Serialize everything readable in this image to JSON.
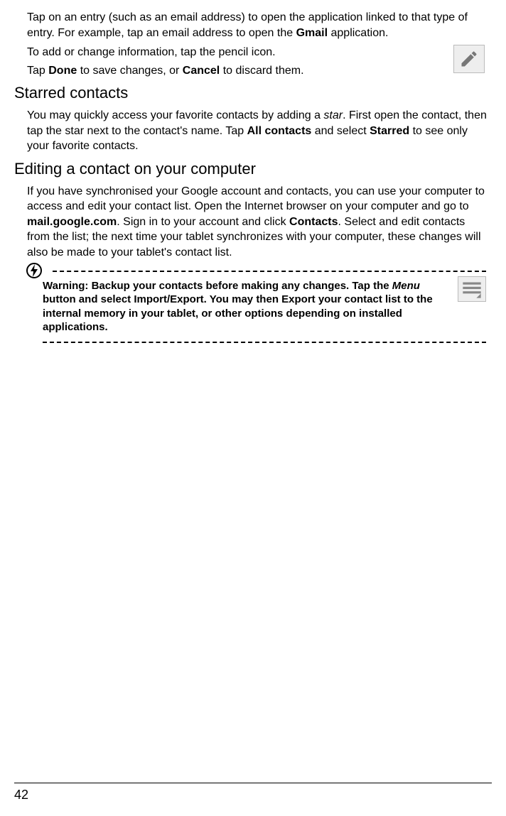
{
  "intro": {
    "tapEntry_pre": "Tap on an entry (such as an email address) to open the application linked to that type of entry. For example, tap an email address to open the ",
    "gmail": "Gmail",
    "tapEntry_post": " application.",
    "pencil": "To add or change information, tap the pencil icon.",
    "done_pre": "Tap ",
    "done": "Done",
    "done_mid": " to save changes, or ",
    "cancel": "Cancel",
    "done_post": " to discard them."
  },
  "starred": {
    "heading": "Starred contacts",
    "body_pre": "You may quickly access your favorite contacts by adding a ",
    "star": "star",
    "body_mid1": ". First open the contact, then tap the star next to the contact's name. Tap ",
    "allcontacts": "All contacts",
    "body_mid2": "  and select ",
    "starredword": "Starred",
    "body_post": " to see only your favorite contacts."
  },
  "editing": {
    "heading": "Editing a contact on your computer",
    "body_pre": "If you have synchronised your Google account and contacts, you can use your computer to access and edit your contact list. Open the Internet browser on your computer and go to ",
    "url": "mail.google.com",
    "body_mid": ". Sign in to your account and click ",
    "contacts": "Contacts",
    "body_post": ". Select and edit contacts from the list; the next time your tablet synchronizes with your computer, these changes will also be made to your tablet's contact list."
  },
  "warning": {
    "pre": "Warning: Backup your contacts before making any changes. Tap the ",
    "menu": "Menu",
    "post": " button and select Import/Export. You may then Export your contact list to the internal memory in your tablet, or other options depending on installed applications."
  },
  "page": "42"
}
